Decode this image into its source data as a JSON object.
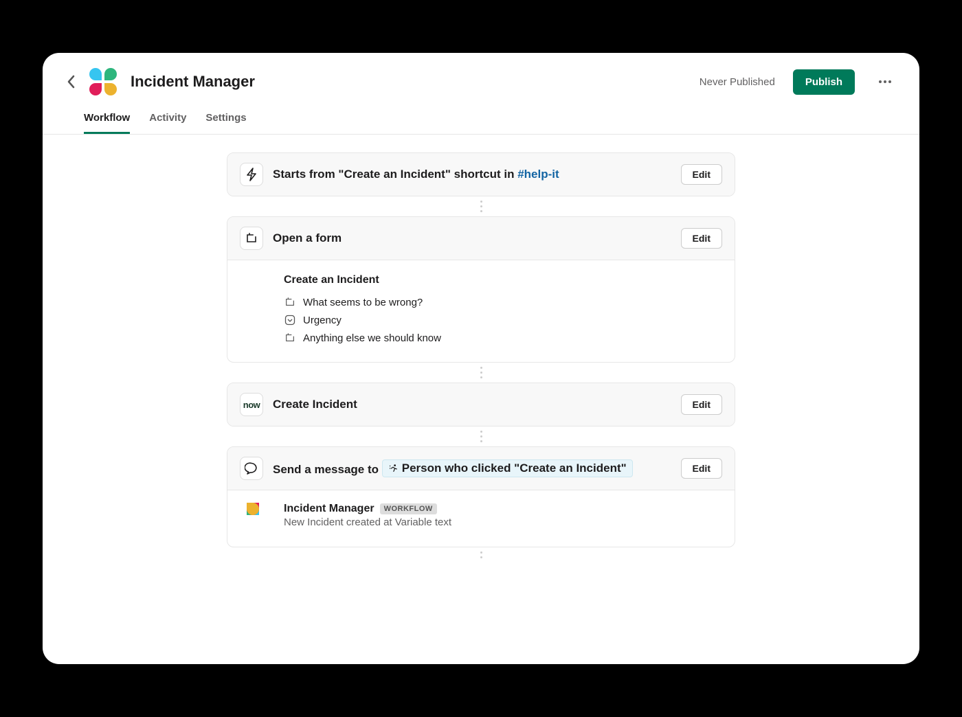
{
  "header": {
    "title": "Incident Manager",
    "status": "Never Published",
    "publish_label": "Publish"
  },
  "tabs": {
    "workflow": "Workflow",
    "activity": "Activity",
    "settings": "Settings"
  },
  "steps": {
    "trigger": {
      "prefix": "Starts from \"Create an Incident\" shortcut in ",
      "channel": "#help-it",
      "edit": "Edit"
    },
    "form": {
      "title": "Open a form",
      "edit": "Edit",
      "form_name": "Create an Incident",
      "fields": [
        {
          "type": "text",
          "label": "What seems to be wrong?"
        },
        {
          "type": "select",
          "label": "Urgency"
        },
        {
          "type": "text",
          "label": "Anything else we should know"
        }
      ]
    },
    "create": {
      "title": "Create Incident",
      "edit": "Edit",
      "app": "now"
    },
    "message": {
      "title_prefix": "Send a message to ",
      "variable": "Person who clicked \"Create an Incident\"",
      "edit": "Edit",
      "app_name": "Incident Manager",
      "badge": "WORKFLOW",
      "body": "New Incident created at Variable text"
    }
  }
}
